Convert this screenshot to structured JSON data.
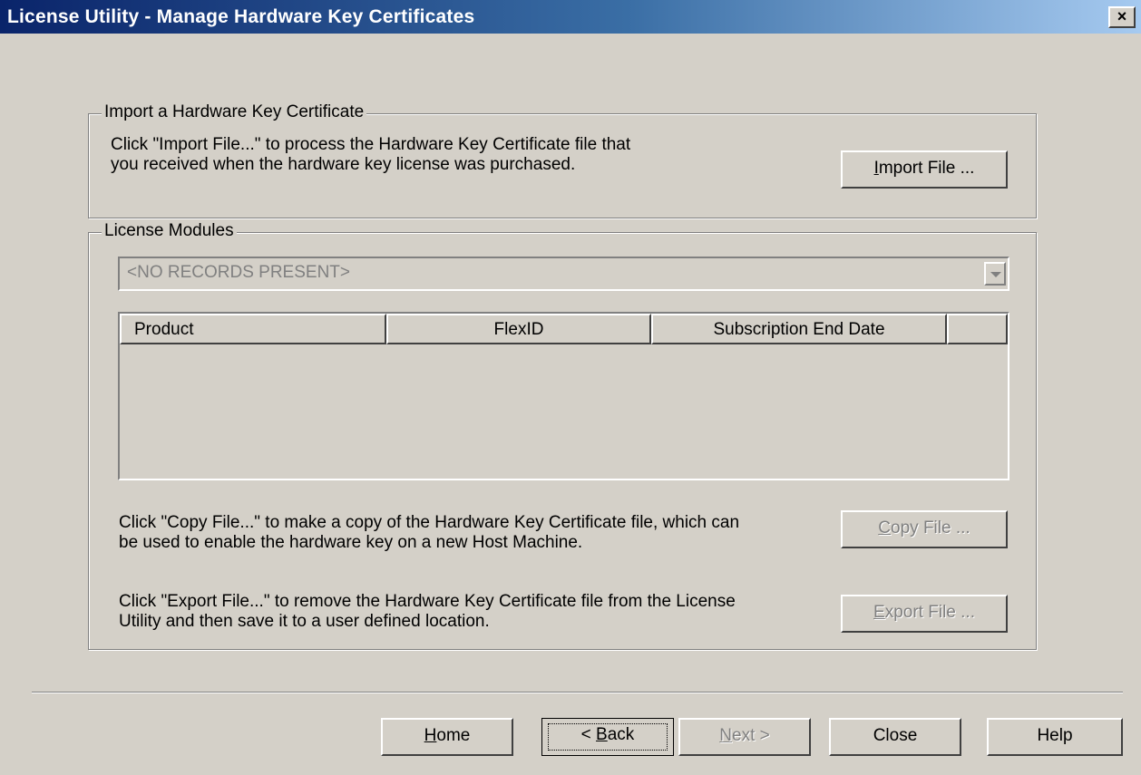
{
  "window": {
    "title": "License Utility - Manage Hardware Key Certificates",
    "close_glyph": "×"
  },
  "import_group": {
    "legend": "Import a Hardware Key Certificate",
    "description_line1": "Click \"Import File...\" to process the Hardware Key Certificate file that",
    "description_line2": "you received when the hardware key license was purchased.",
    "import_button": {
      "mnemonic": "I",
      "rest": "mport File ..."
    }
  },
  "modules_group": {
    "legend": "License Modules",
    "combo_value": "<NO RECORDS PRESENT>",
    "columns": [
      "Product",
      "FlexID",
      "Subscription End Date",
      ""
    ],
    "copy_desc_line1": "Click \"Copy File...\" to make a copy of the Hardware Key Certificate file, which can",
    "copy_desc_line2": "be used to enable the hardware key on a new Host Machine.",
    "copy_button": {
      "mnemonic": "C",
      "rest": "opy File ..."
    },
    "export_desc_line1": "Click \"Export File...\" to remove the Hardware Key Certificate file from the License",
    "export_desc_line2": "Utility and then save it to a user defined location.",
    "export_button": {
      "mnemonic": "E",
      "rest": "xport File ..."
    }
  },
  "footer": {
    "home": {
      "mnemonic": "H",
      "rest": "ome"
    },
    "back": {
      "prefix": "< ",
      "mnemonic": "B",
      "rest": "ack"
    },
    "next": {
      "mnemonic": "N",
      "rest": "ext >"
    },
    "close": "Close",
    "help": "Help"
  }
}
